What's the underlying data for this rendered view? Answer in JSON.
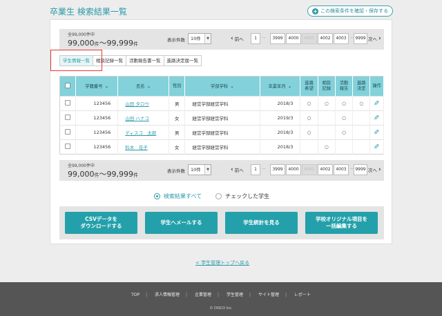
{
  "page": {
    "title": "卒業生 検索結果一覧",
    "save_conditions_label": "この検索条件を確認・保存する"
  },
  "pager": {
    "total_small": "全99,000件中",
    "range_from": "99,000",
    "range_to": "99,999",
    "unit": "件",
    "range_sep": "～",
    "per_page_label": "表示件数",
    "per_page_value": "10件",
    "prev_label": "前へ",
    "next_label": "次へ",
    "pages": [
      "1",
      "3999",
      "4000",
      "4001",
      "4002",
      "4003",
      "9999"
    ],
    "current_page": "4001",
    "ellipsis": "…"
  },
  "tabs": [
    "学生情報一覧",
    "相談記録一覧",
    "活動報告書一覧",
    "進路決定届一覧"
  ],
  "table": {
    "headers": [
      "学籍番号",
      "氏名",
      "性別",
      "学部学科",
      "卒業年月",
      "進路希望",
      "相談記録",
      "活動報告",
      "進路決定",
      "操作"
    ],
    "header_wrapped": {
      "path_hope": [
        "進路",
        "希望"
      ],
      "consult": [
        "相談",
        "記録"
      ],
      "activity": [
        "活動",
        "報告"
      ],
      "decided": [
        "進路",
        "決定"
      ]
    },
    "rows": [
      {
        "id": "123456",
        "name": "山田 タロウ",
        "gender": "男",
        "dept": "経営学部経営学科",
        "grad": "2018/3",
        "hope": "○",
        "consult": "○",
        "activity": "○",
        "decided": "○"
      },
      {
        "id": "123456",
        "name": "山田 ハナコ",
        "gender": "女",
        "dept": "経営学部経営学科",
        "grad": "2019/3",
        "hope": "○",
        "consult": "",
        "activity": "○",
        "decided": ""
      },
      {
        "id": "123456",
        "name": "ディスコ　太郎",
        "gender": "男",
        "dept": "経営学部経営学科",
        "grad": "2018/3",
        "hope": "○",
        "consult": "",
        "activity": "○",
        "decided": ""
      },
      {
        "id": "123456",
        "name": "鈴木　花子",
        "gender": "女",
        "dept": "経営学部経営学科",
        "grad": "2018/3",
        "hope": "",
        "consult": "○",
        "activity": "",
        "decided": ""
      }
    ]
  },
  "scope": {
    "all_label": "検索結果すべて",
    "checked_label": "チェックした学生",
    "selected": "all"
  },
  "actions": {
    "csv": [
      "CSVデータを",
      "ダウンロードする"
    ],
    "mail": "学生へメールする",
    "stats": "学生統計を見る",
    "bulk": [
      "学校オリジナル項目を",
      "一括編集する"
    ]
  },
  "back_link": "< 学生管理トップへ戻る",
  "footer": {
    "nav": [
      "TOP",
      "求人情報管理",
      "企業管理",
      "学生管理",
      "サイト管理",
      "レポート"
    ],
    "separator": "|",
    "copyright": "© DISCO Inc."
  },
  "colors": {
    "accent": "#2a9aa8",
    "header_bg": "#83d1da",
    "button_bg": "#23a0aa",
    "footer_bg": "#555555",
    "highlight_red": "#e53935"
  }
}
